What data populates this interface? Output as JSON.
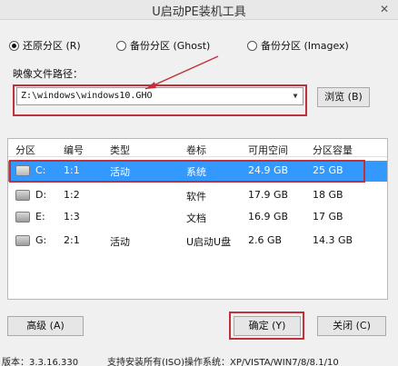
{
  "window": {
    "title": "U启动PE装机工具",
    "close_glyph": "✕"
  },
  "modes": [
    {
      "label": "还原分区 (R)",
      "selected": true
    },
    {
      "label": "备份分区 (Ghost)",
      "selected": false
    },
    {
      "label": "备份分区 (Imagex)",
      "selected": false
    }
  ],
  "path": {
    "label": "映像文件路径：",
    "value": "Z:\\windows\\windows10.GHO"
  },
  "buttons": {
    "browse": "浏览 (B)",
    "advanced": "高级 (A)",
    "ok": "确定 (Y)",
    "close": "关闭 (C)"
  },
  "table": {
    "headers": [
      "分区",
      "编号",
      "类型",
      "卷标",
      "可用空间",
      "分区容量"
    ],
    "rows": [
      {
        "drive": "C:",
        "num": "1:1",
        "type": "活动",
        "label": "系统",
        "free": "24.9 GB",
        "size": "25 GB",
        "selected": true
      },
      {
        "drive": "D:",
        "num": "1:2",
        "type": "",
        "label": "软件",
        "free": "17.9 GB",
        "size": "18 GB",
        "selected": false
      },
      {
        "drive": "E:",
        "num": "1:3",
        "type": "",
        "label": "文档",
        "free": "16.9 GB",
        "size": "17 GB",
        "selected": false
      },
      {
        "drive": "G:",
        "num": "2:1",
        "type": "活动",
        "label": "U启动U盘",
        "free": "2.6 GB",
        "size": "14.3 GB",
        "selected": false
      }
    ]
  },
  "status": {
    "version": "版本：3.3.16.330",
    "support": "支持安装所有(ISO)操作系统：XP/VISTA/WIN7/8/8.1/10"
  },
  "colors": {
    "annotation": "#c0313a",
    "selection": "#3399ff"
  }
}
